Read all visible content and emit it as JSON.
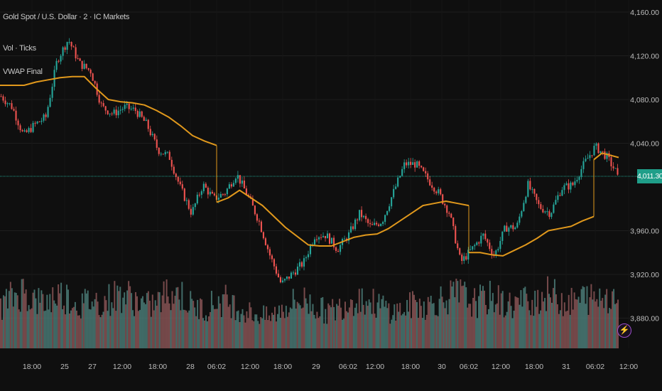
{
  "legend": {
    "symbol": "Gold Spot / U.S. Dollar · 2 · IC Markets",
    "volume": "Vol · Ticks",
    "indicator": "VWAP Final"
  },
  "last_price": "4,011.30",
  "icons": {
    "alert": "lightning-icon"
  },
  "colors": {
    "background": "#0f0f0f",
    "up": "#26a69a",
    "down": "#ef5350",
    "vwap": "#e0981c",
    "last_price": "#1f9e89",
    "grid": "#1e1e1e",
    "alert": "#9c4dcc"
  },
  "chart_data": {
    "type": "candlestick",
    "ylim": [
      3860,
      4170
    ],
    "y_ticks": [
      "4,160.00",
      "4,120.00",
      "4,080.00",
      "4,040.00",
      "3,960.00",
      "3,920.00",
      "3,880.00"
    ],
    "y_tick_values": [
      4160,
      4120,
      4080,
      4040,
      3960,
      3920,
      3880
    ],
    "x_ticks": [
      "18:00",
      "25",
      "27",
      "12:00",
      "18:00",
      "28",
      "06:02",
      "12:00",
      "18:00",
      "29",
      "06:02",
      "12:00",
      "18:00",
      "30",
      "06:02",
      "12:00",
      "18:00",
      "31",
      "06:02",
      "12:00"
    ],
    "grid": true,
    "close_path": [
      4083,
      4073,
      4047,
      4057,
      4064,
      4116,
      4135,
      4113,
      4106,
      4073,
      4067,
      4073,
      4070,
      4057,
      4034,
      4028,
      3999,
      3976,
      4002,
      3989,
      3995,
      4012,
      3992,
      3969,
      3937,
      3911,
      3921,
      3931,
      3956,
      3956,
      3943,
      3956,
      3976,
      3963,
      3969,
      3995,
      4021,
      4021,
      4008,
      3995,
      3976,
      3931,
      3943,
      3956,
      3937,
      3963,
      3963,
      4002,
      3982,
      3976,
      3999,
      4002,
      4021,
      4037,
      4028,
      4011.3
    ],
    "vwap_segments": [
      [
        4093,
        4093,
        4093,
        4096,
        4098,
        4100,
        4101,
        4101,
        4090,
        4080,
        4078,
        4077,
        4075,
        4070,
        4064,
        4056,
        4047,
        4042,
        4038
      ],
      [
        3986,
        3990,
        3997,
        3990,
        3983,
        3973,
        3963,
        3955,
        3947,
        3946,
        3946,
        3950,
        3954,
        3956,
        3957,
        3962,
        3969,
        3976,
        3983,
        3985,
        3987,
        3985,
        3983
      ],
      [
        3940,
        3940,
        3938,
        3937,
        3942,
        3947,
        3953,
        3960,
        3962,
        3964,
        3969,
        3973
      ],
      [
        4025,
        4031,
        4029,
        4027
      ]
    ],
    "volume_profile": [
      70,
      85,
      95,
      80,
      75,
      90,
      85,
      70,
      80,
      75,
      85,
      90,
      80,
      70,
      75,
      95,
      90,
      70,
      65,
      75,
      80,
      70,
      60,
      55,
      50,
      65,
      75,
      80,
      70,
      60,
      65,
      80,
      85,
      75,
      70,
      60,
      65,
      75,
      70,
      80,
      85,
      90,
      75,
      80,
      85,
      70,
      75,
      80,
      85,
      90,
      80,
      75,
      85,
      80,
      90,
      85
    ]
  }
}
